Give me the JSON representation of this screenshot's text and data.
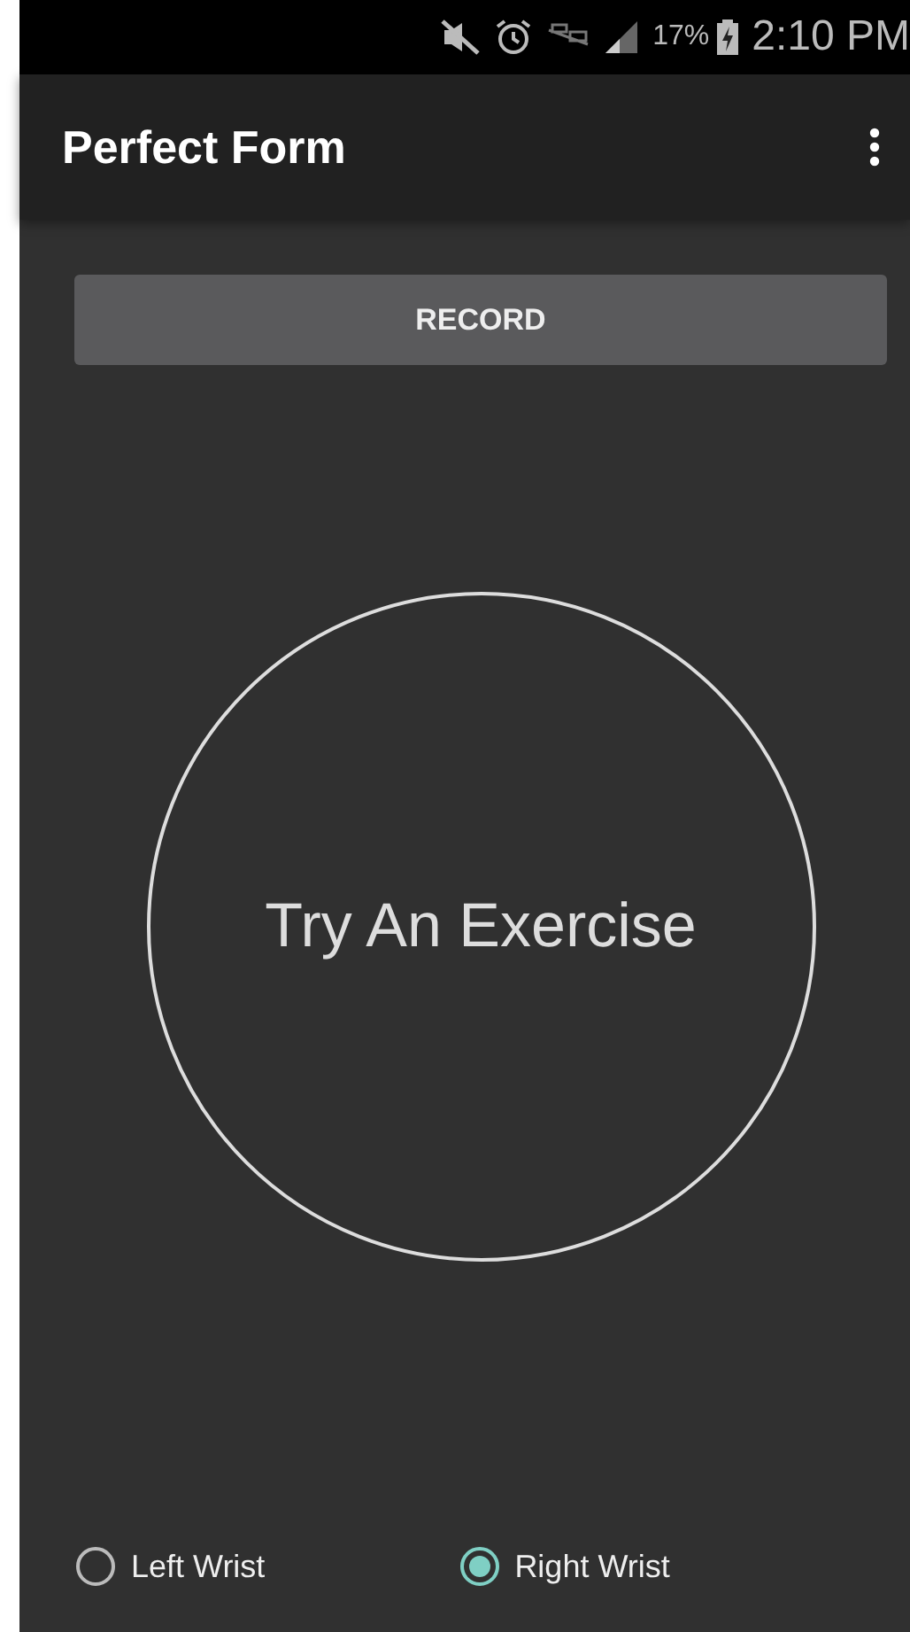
{
  "status_bar": {
    "battery": "17%",
    "time": "2:10 PM"
  },
  "app_bar": {
    "title": "Perfect Form"
  },
  "record_button": {
    "label": "RECORD"
  },
  "prompt": {
    "text": "Try An Exercise"
  },
  "wrist_options": [
    {
      "label": "Left Wrist",
      "selected": false
    },
    {
      "label": "Right Wrist",
      "selected": true
    }
  ]
}
